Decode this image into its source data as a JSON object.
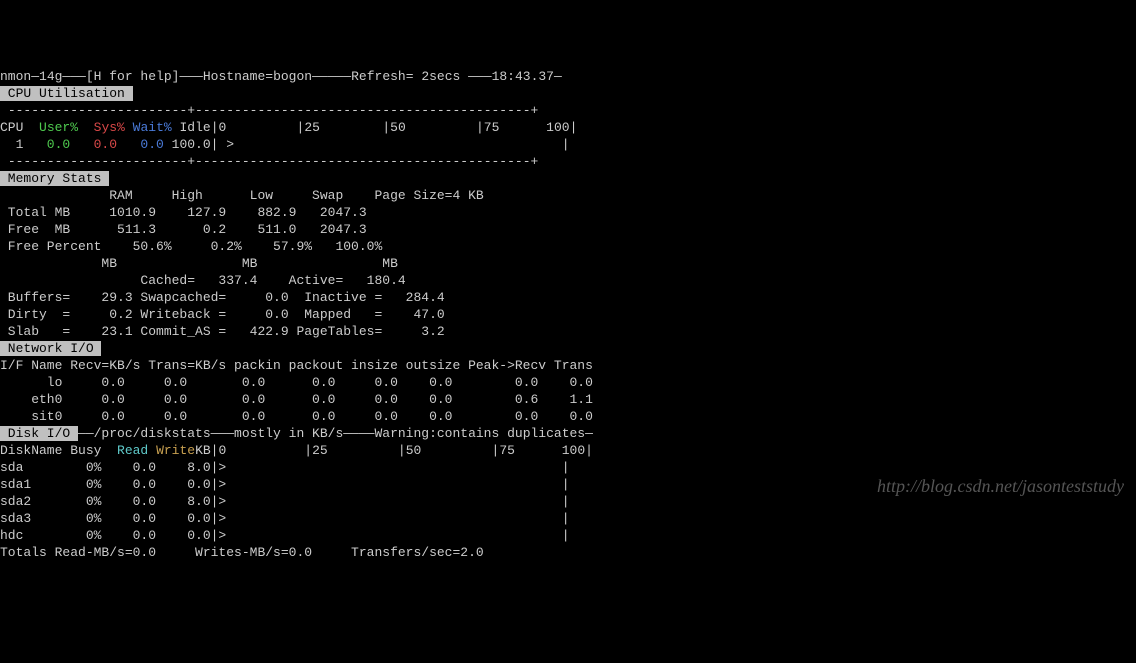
{
  "header": {
    "prefix": "nmon—",
    "version": "14g",
    "help": "[H for help]",
    "hostLabel": "Hostname=",
    "hostname": "bogon",
    "refreshLabel": "Refresh=",
    "refreshValue": " 2secs",
    "time": "18:43.37"
  },
  "cpu": {
    "title": " CPU Utilisation ",
    "hdr": {
      "cpu": "CPU",
      "user": "User%",
      "sys": "Sys%",
      "wait": "Wait%",
      "idle": "Idle",
      "bar": "|0         |25        |50         |75      100|"
    },
    "row": {
      "id": "  1",
      "user": "   0.0",
      "sys": "   0.0",
      "wait": "   0.0",
      "idle": " 100.0",
      "bar": "| >                                          |"
    },
    "rule": "-----------------------+-------------------------------------------+"
  },
  "mem": {
    "title": " Memory Stats ",
    "hdr": "              RAM     High      Low     Swap    Page Size=4 KB",
    "r1": " Total MB     1010.9    127.9    882.9   2047.3",
    "r2": " Free  MB      511.3      0.2    511.0   2047.3",
    "r3": " Free Percent    50.6%     0.2%    57.9%   100.0%",
    "r4": "             MB                MB                MB",
    "r5": "                  Cached=   337.4    Active=   180.4",
    "r6": " Buffers=    29.3 Swapcached=     0.0  Inactive =   284.4",
    "r7": " Dirty  =     0.2 Writeback =     0.0  Mapped   =    47.0",
    "r8": " Slab   =    23.1 Commit_AS =   422.9 PageTables=     3.2"
  },
  "net": {
    "title": " Network I/O ",
    "hdr": "I/F Name Recv=KB/s Trans=KB/s packin packout insize outsize Peak->Recv Trans",
    "rows": [
      "      lo     0.0     0.0       0.0      0.0     0.0    0.0        0.0    0.0",
      "    eth0     0.0     0.0       0.0      0.0     0.0    0.0        0.6    1.1",
      "    sit0     0.0     0.0       0.0      0.0     0.0    0.0        0.0    0.0"
    ]
  },
  "disk": {
    "title": " Disk I/O ",
    "titleSuffix": "——/proc/diskstats———mostly in KB/s————Warning:contains duplicates—",
    "hdr": {
      "pre": "DiskName Busy  ",
      "read": "Read",
      "space": " ",
      "write": "Write",
      "post": "KB|0          |25         |50         |75      100|"
    },
    "rows": [
      "sda        0%    0.0    8.0|>                                           |",
      "sda1       0%    0.0    0.0|>                                           |",
      "sda2       0%    0.0    8.0|>                                           |",
      "sda3       0%    0.0    0.0|>                                           |",
      "hdc        0%    0.0    0.0|>                                           |"
    ],
    "totals": "Totals Read-MB/s=0.0     Writes-MB/s=0.0     Transfers/sec=2.0"
  },
  "watermark": "http://blog.csdn.net/jasonteststudy"
}
